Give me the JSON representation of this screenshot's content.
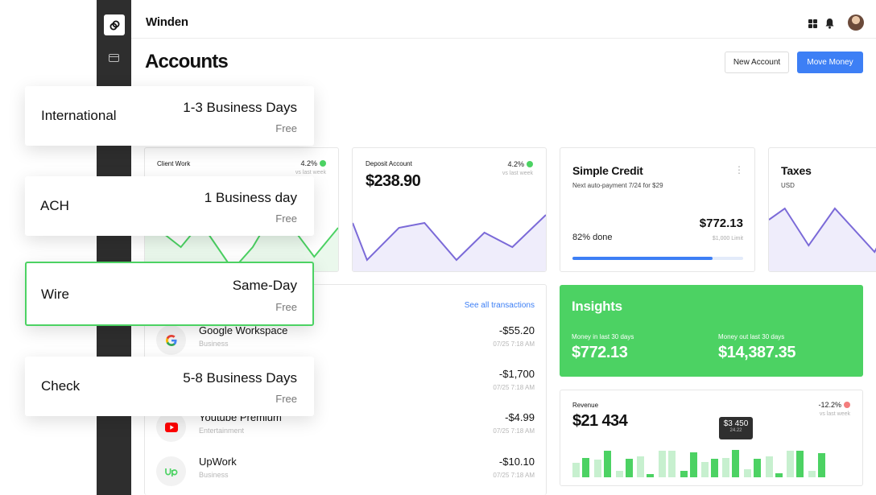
{
  "header": {
    "brand": "Winden",
    "page_title": "Accounts",
    "new_account_label": "New Account",
    "move_money_label": "Move Money"
  },
  "icons": {
    "logo": "coins-logo-icon",
    "sidebar_nav": "card-icon",
    "apps": "grid-icon",
    "notifications": "bell-icon"
  },
  "cards": {
    "client_work": {
      "title": "Client Work",
      "change": "4.2%",
      "compare": "vs last week"
    },
    "deposit": {
      "title": "Deposit Account",
      "amount": "$238.90",
      "change": "4.2%",
      "compare": "vs last week"
    },
    "simple_credit": {
      "title": "Simple Credit",
      "subtitle": "Next auto-payment 7/24 for $29",
      "percent_label": "82% done",
      "progress": 0.82,
      "amount": "$772.13",
      "limit": "$1,000 Limit"
    },
    "taxes": {
      "title": "Taxes",
      "currency": "USD"
    }
  },
  "transactions": {
    "see_all": "See all transactions",
    "items": [
      {
        "name": "Google Workspace",
        "category": "Business",
        "amount": "-$55.20",
        "time": "07/25 7:18 AM"
      },
      {
        "name": "",
        "category": "",
        "amount": "-$1,700",
        "time": "07/25 7:18 AM"
      },
      {
        "name": "Youtube Premium",
        "category": "Entertainment",
        "amount": "-$4.99",
        "time": "07/25 7:18 AM"
      },
      {
        "name": "UpWork",
        "category": "Business",
        "amount": "-$10.10",
        "time": "07/25 7:18 AM"
      }
    ]
  },
  "insights": {
    "title": "Insights",
    "in_label": "Money in last 30 days",
    "in_value": "$772.13",
    "out_label": "Money out last 30 days",
    "out_value": "$14,387.35"
  },
  "revenue": {
    "title": "Revenue",
    "amount": "$21 434",
    "change": "-12.2%",
    "compare": "vs last week",
    "tooltip_value": "$3 450",
    "tooltip_sub": "24.22"
  },
  "transfer_modes": [
    {
      "name": "International",
      "time": "1-3 Business Days",
      "fee": "Free",
      "selected": false
    },
    {
      "name": "ACH",
      "time": "1 Business day",
      "fee": "Free",
      "selected": false
    },
    {
      "name": "Wire",
      "time": "Same-Day",
      "fee": "Free",
      "selected": true
    },
    {
      "name": "Check",
      "time": "5-8 Business Days",
      "fee": "Free",
      "selected": false
    }
  ],
  "colors": {
    "accent_blue": "#3d7ff5",
    "accent_green": "#4cd263",
    "sidebar": "#2e2e2e",
    "chart_purple": "#7b6ad8"
  }
}
